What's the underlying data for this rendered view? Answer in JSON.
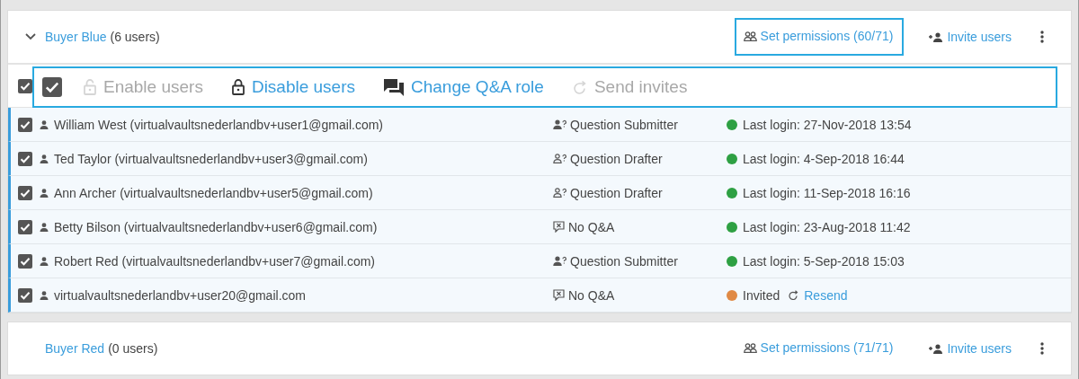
{
  "groups": [
    {
      "name": "Buyer Blue",
      "count": "(6 users)",
      "expanded": true,
      "permissions": {
        "label": "Set permissions (60/71)",
        "highlighted": true
      },
      "invite": "Invite users",
      "header_checked": true,
      "bulk_bar": {
        "highlighted": true,
        "select_all_checked": true,
        "actions": [
          {
            "kind": "enable",
            "label": "Enable users",
            "disabled": true
          },
          {
            "kind": "disable",
            "label": "Disable users",
            "disabled": false
          },
          {
            "kind": "role",
            "label": "Change Q&A role",
            "disabled": false
          },
          {
            "kind": "invite",
            "label": "Send invites",
            "disabled": true
          }
        ]
      },
      "users": [
        {
          "name": "William West (virtualvaultsnederlandbv+user1@gmail.com)",
          "checked": true,
          "selected": true,
          "kind": "submitter",
          "role": "Question Submitter",
          "status": "Last login: 27-Nov-2018 13:54",
          "color": "#2ea043"
        },
        {
          "name": "Ted Taylor (virtualvaultsnederlandbv+user3@gmail.com)",
          "checked": true,
          "selected": true,
          "kind": "drafter",
          "role": "Question Drafter",
          "status": "Last login: 4-Sep-2018 16:44",
          "color": "#2ea043"
        },
        {
          "name": "Ann Archer (virtualvaultsnederlandbv+user5@gmail.com)",
          "checked": true,
          "selected": true,
          "kind": "drafter",
          "role": "Question Drafter",
          "status": "Last login: 11-Sep-2018 16:16",
          "color": "#2ea043"
        },
        {
          "name": "Betty Bilson (virtualvaultsnederlandbv+user6@gmail.com)",
          "checked": true,
          "selected": true,
          "kind": "none",
          "role": "No Q&A",
          "status": "Last login: 23-Aug-2018 11:42",
          "color": "#2ea043"
        },
        {
          "name": "Robert Red (virtualvaultsnederlandbv+user7@gmail.com)",
          "checked": true,
          "selected": true,
          "kind": "submitter",
          "role": "Question Submitter",
          "status": "Last login: 5-Sep-2018 15:03",
          "color": "#2ea043"
        },
        {
          "name": "virtualvaultsnederlandbv+user20@gmail.com",
          "checked": true,
          "selected": true,
          "kind": "none",
          "role": "No Q&A",
          "status": "Invited",
          "color": "#e08a45",
          "resend": "Resend"
        }
      ]
    },
    {
      "name": "Buyer Red",
      "count": "(0 users)",
      "expanded": false,
      "permissions": {
        "label": "Set permissions (71/71)",
        "highlighted": false
      },
      "invite": "Invite users"
    }
  ]
}
